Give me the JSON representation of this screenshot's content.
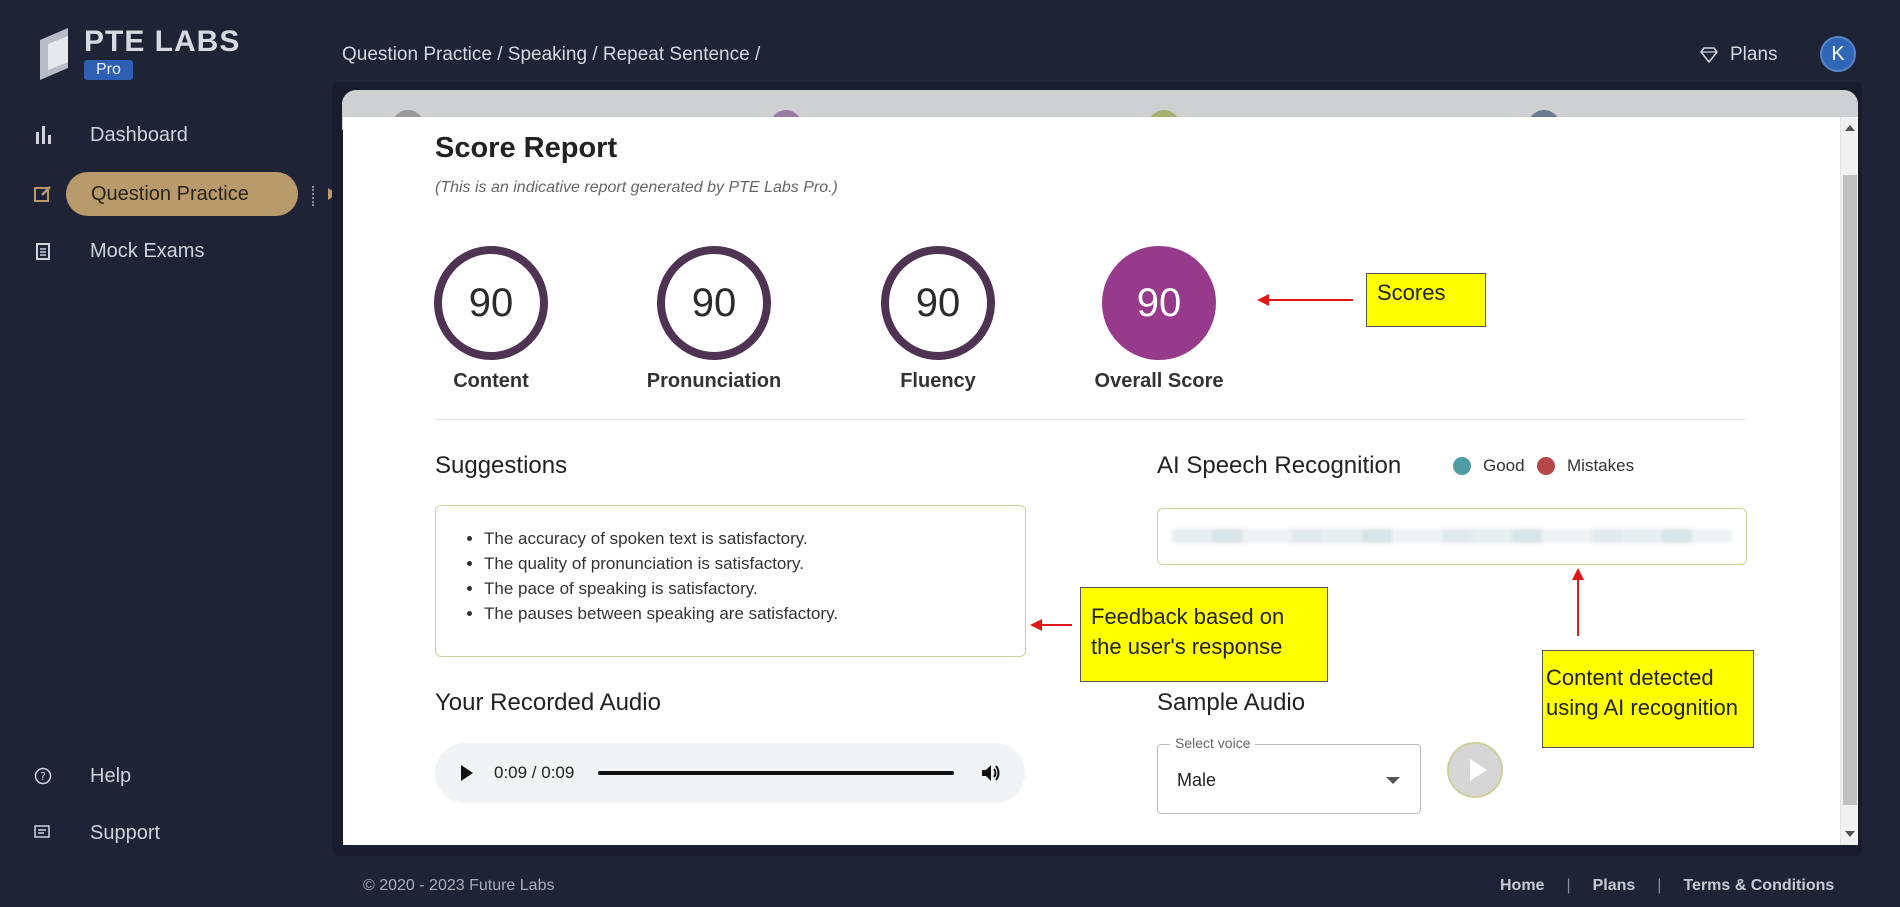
{
  "brand": {
    "name": "PTE LABS",
    "badge": "Pro"
  },
  "sidebar": {
    "items": [
      {
        "label": "Dashboard",
        "icon": "bar-chart-icon"
      },
      {
        "label": "Question Practice",
        "icon": "edit-icon",
        "active": true
      },
      {
        "label": "Mock Exams",
        "icon": "clipboard-icon"
      }
    ],
    "bottom": [
      {
        "label": "Help",
        "icon": "help-circle-icon"
      },
      {
        "label": "Support",
        "icon": "support-icon"
      }
    ]
  },
  "topbar": {
    "breadcrumb": "Question Practice / Speaking / Repeat Sentence /",
    "plans_label": "Plans",
    "avatar_initial": "K"
  },
  "report": {
    "title": "Score Report",
    "subtitle": "This is an indicative report generated by PTE Labs Pro.",
    "scores": [
      {
        "label": "Content",
        "value": "90"
      },
      {
        "label": "Pronunciation",
        "value": "90"
      },
      {
        "label": "Fluency",
        "value": "90"
      },
      {
        "label": "Overall Score",
        "value": "90"
      }
    ],
    "suggestions_title": "Suggestions",
    "suggestions": [
      "The accuracy of spoken text is satisfactory.",
      "The quality of pronunciation is satisfactory.",
      "The pace of speaking is satisfactory.",
      "The pauses between speaking are satisfactory."
    ],
    "speech_title": "AI Speech Recognition",
    "legend_good": "Good",
    "legend_mistakes": "Mistakes",
    "recorded_title": "Your Recorded Audio",
    "audio_time": "0:09 / 0:09",
    "sample_title": "Sample Audio",
    "voice_label": "Select voice",
    "voice_value": "Male"
  },
  "annotations": {
    "scores": "Scores",
    "feedback": "Feedback based on the user's response",
    "content": "Content detected using AI recognition"
  },
  "footer": {
    "copyright": "© 2020 - 2023 Future Labs",
    "links": [
      "Home",
      "Plans",
      "Terms & Conditions"
    ]
  },
  "colors": {
    "background": "#1e2336",
    "accent_pill": "#b99a6a",
    "ring": "#4e3352",
    "overall": "#973a8c",
    "good": "#4e9da3",
    "mistakes": "#b5474b",
    "annotation": "#ffff00"
  }
}
